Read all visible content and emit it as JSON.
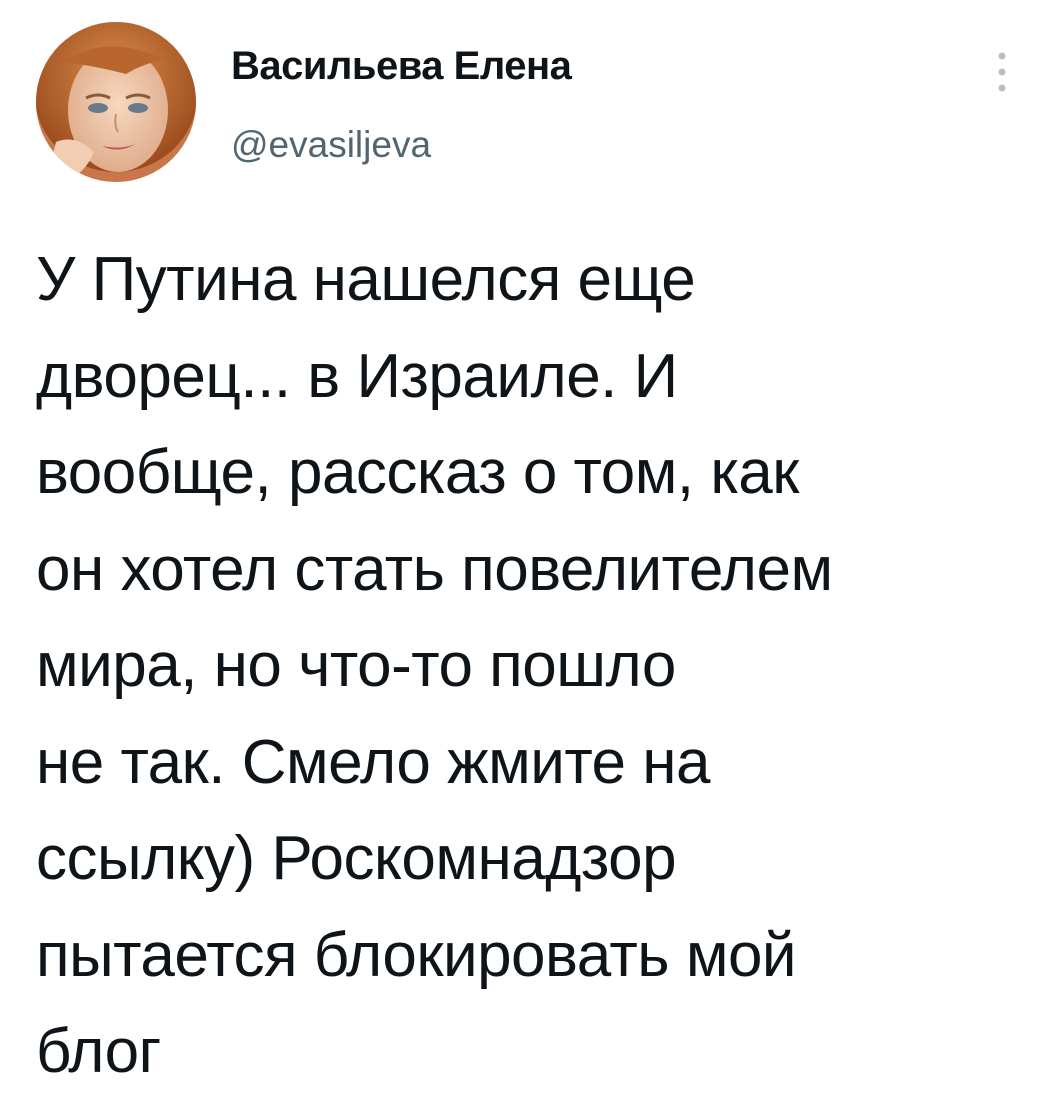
{
  "author": {
    "name": "Васильева Елена",
    "handle": "@evasiljeva"
  },
  "more_icon": "more-vertical-icon",
  "tweet": {
    "lines": [
      "У Путина нашелся еще",
      "дворец... в Израиле. И",
      "вообще, рассказ о том, как",
      "он хотел стать повелителем",
      "мира, но что-то пошло",
      "не так. Смело жмите на",
      "ссылку) Роскомнадзор",
      "пытается блокировать мой",
      "блог"
    ]
  },
  "colors": {
    "text": "#0f1419",
    "secondary": "#536471",
    "background": "#ffffff"
  }
}
